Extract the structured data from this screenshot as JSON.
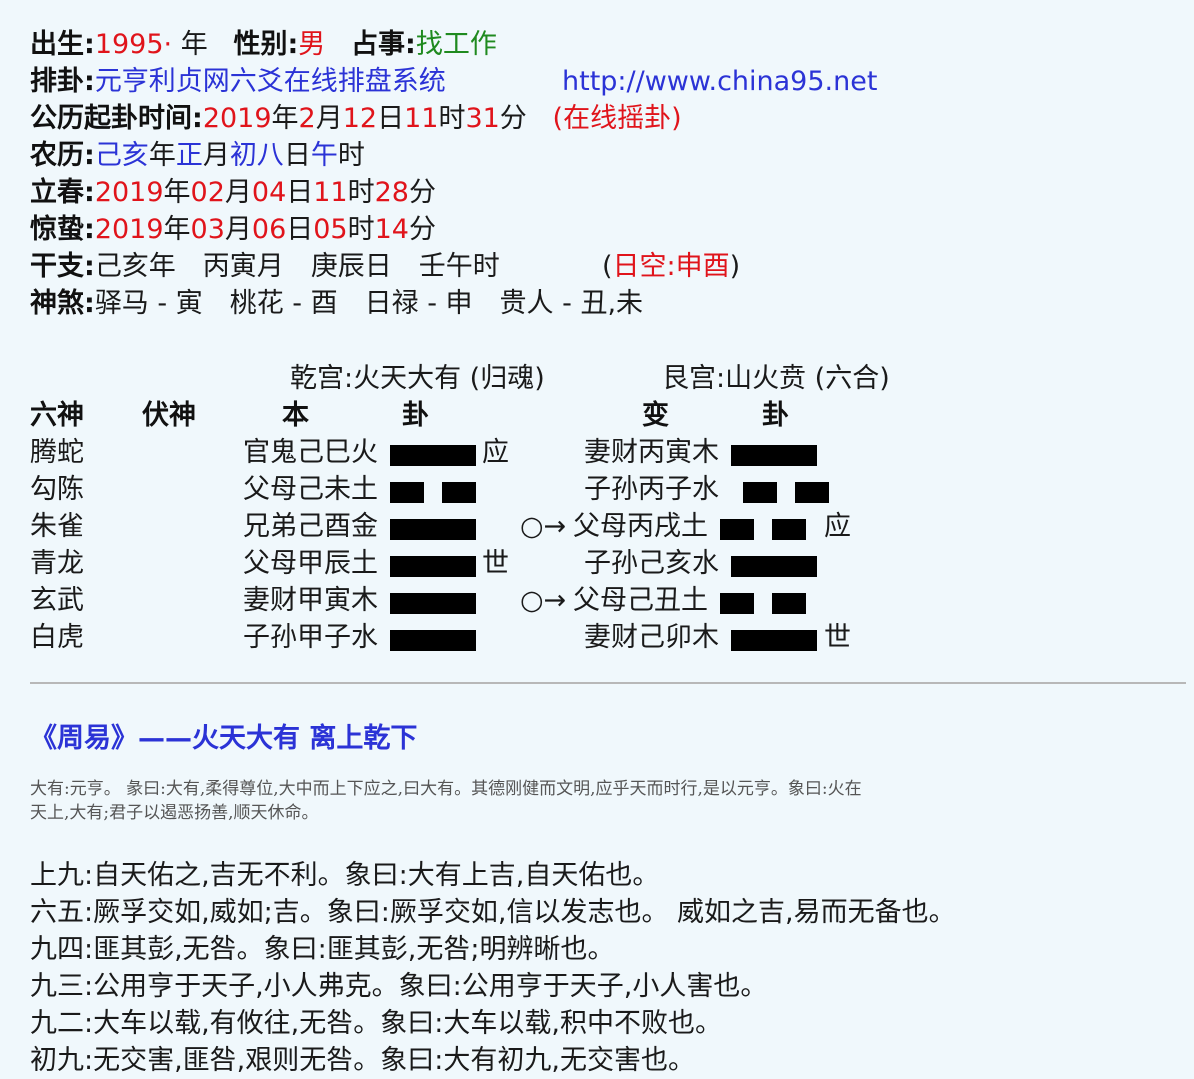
{
  "info": {
    "birth_label": "出生:",
    "birth_year": "1995·",
    "birth_year_unit": "年",
    "gender_label": "性别:",
    "gender_value": "男",
    "topic_label": "占事:",
    "topic_value": "找工作",
    "pai_label": "排卦:",
    "pai_system": "元亨利贞网六爻在线排盘系统",
    "pai_url": "http://www.china95.net",
    "time_label": "公历起卦时间:",
    "time_y": "2019",
    "time_y_u": "年",
    "time_m": "2",
    "time_m_u": "月",
    "time_d": "12",
    "time_d_u": "日",
    "time_h": "11",
    "time_h_u": "时",
    "time_min": "31",
    "time_min_u": "分",
    "time_note": "(在线摇卦)",
    "lunar_label": "农历:",
    "lunar_year": "己亥",
    "lunar_year_u": "年",
    "lunar_month": "正",
    "lunar_month_u": "月",
    "lunar_day": "初八",
    "lunar_day_u": "日",
    "lunar_hour": "午",
    "lunar_hour_u": "时",
    "lichun_label": "立春:",
    "lichun_y": "2019",
    "lichun_m": "02",
    "lichun_d": "04",
    "lichun_h": "11",
    "lichun_min": "28",
    "jingzhe_label": "惊蛰:",
    "jingzhe_y": "2019",
    "jingzhe_m": "03",
    "jingzhe_d": "06",
    "jingzhe_h": "05",
    "jingzhe_min": "14",
    "u_year": "年",
    "u_month": "月",
    "u_day": "日",
    "u_hour": "时",
    "u_min": "分",
    "ganzhi_label": "干支:",
    "ganzhi_value": "己亥年　丙寅月　庚辰日　壬午时",
    "kong_open": "(",
    "kong_value": "日空:申酉",
    "kong_close": ")",
    "shensha_label": "神煞:",
    "shensha_value": "驿马 - 寅　桃花 - 酉　日禄 - 申　贵人 - 丑,未"
  },
  "gua": {
    "ben_palace": "乾宫:火天大有 (归魂)",
    "bian_palace": "艮宫:山火贲 (六合)",
    "head_liushen": "六神",
    "head_fushen": "伏神",
    "head_ben": "本",
    "head_gua1": "卦",
    "head_bian": "变",
    "head_gua2": "卦",
    "rows": [
      {
        "liushen": "腾蛇",
        "ben": "官鬼己巳火",
        "ben_line": "yang",
        "ben_mark": "应",
        "moving": "",
        "bian": "妻财丙寅木",
        "bian_line": "yang",
        "bian_mark": ""
      },
      {
        "liushen": "勾陈",
        "ben": "父母己未土",
        "ben_line": "yin",
        "ben_mark": "",
        "moving": "",
        "bian": "子孙丙子水",
        "bian_line": "yin",
        "bian_mark": ""
      },
      {
        "liushen": "朱雀",
        "ben": "兄弟己酉金",
        "ben_line": "yang",
        "ben_mark": "",
        "moving": "○→",
        "bian": "父母丙戌土",
        "bian_line": "yin",
        "bian_mark": "应"
      },
      {
        "liushen": "青龙",
        "ben": "父母甲辰土",
        "ben_line": "yang",
        "ben_mark": "世",
        "moving": "",
        "bian": "子孙己亥水",
        "bian_line": "yang",
        "bian_mark": ""
      },
      {
        "liushen": "玄武",
        "ben": "妻财甲寅木",
        "ben_line": "yang",
        "ben_mark": "",
        "moving": "○→",
        "bian": "父母己丑土",
        "bian_line": "yin",
        "bian_mark": ""
      },
      {
        "liushen": "白虎",
        "ben": "子孙甲子水",
        "ben_line": "yang",
        "ben_mark": "",
        "moving": "",
        "bian": "妻财己卯木",
        "bian_line": "yang",
        "bian_mark": "世"
      }
    ]
  },
  "zhouyi": {
    "title": "《周易》——火天大有 离上乾下",
    "tuan_line1": "大有:元亨。 彖曰:大有,柔得尊位,大中而上下应之,曰大有。其德刚健而文明,应乎天而时行,是以元亨。象曰:火在",
    "tuan_line2": "天上,大有;君子以遏恶扬善,顺天休命。",
    "yao": [
      "上九:自天佑之,吉无不利。象曰:大有上吉,自天佑也。",
      "六五:厥孚交如,威如;吉。象曰:厥孚交如,信以发志也。 威如之吉,易而无备也。",
      "九四:匪其彭,无咎。象曰:匪其彭,无咎;明辨晰也。",
      "九三:公用亨于天子,小人弗克。象曰:公用亨于天子,小人害也。",
      "九二:大车以载,有攸往,无咎。象曰:大车以载,积中不败也。",
      "初九:无交害,匪咎,艰则无咎。象曰:大有初九,无交害也。"
    ]
  }
}
